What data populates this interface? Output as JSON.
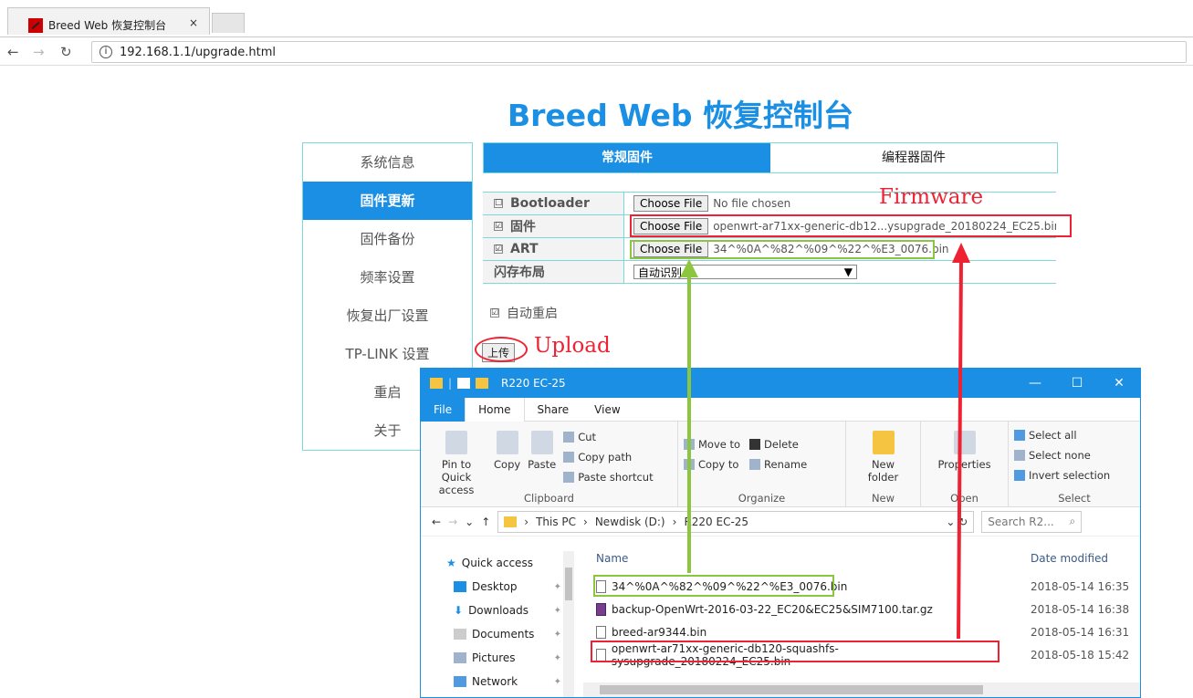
{
  "browser": {
    "tab_title": "Breed Web 恢复控制台",
    "tab_close": "×",
    "url": "192.168.1.1/upgrade.html"
  },
  "page": {
    "title": "Breed Web 恢复控制台",
    "sidebar": [
      {
        "label": "系统信息"
      },
      {
        "label": "固件更新"
      },
      {
        "label": "固件备份"
      },
      {
        "label": "频率设置"
      },
      {
        "label": "恢复出厂设置"
      },
      {
        "label": "TP-LINK 设置"
      },
      {
        "label": "重启"
      },
      {
        "label": "关于"
      }
    ],
    "tabs": [
      "常规固件",
      "编程器固件"
    ],
    "rows": {
      "bootloader": {
        "label": "Bootloader",
        "button": "Choose File",
        "value": "No file chosen",
        "checked": "☐"
      },
      "firmware": {
        "label": "固件",
        "button": "Choose File",
        "value": "openwrt-ar71xx-generic-db12...ysupgrade_20180224_EC25.bin",
        "checked": "☑"
      },
      "art": {
        "label": "ART",
        "button": "Choose File",
        "value": "34^%0A^%82^%09^%22^%E3_0076.bin",
        "checked": "☑"
      },
      "flash": {
        "label": "闪存布局",
        "select": "自动识别",
        "arrow": "▼"
      }
    },
    "auto_reboot": {
      "label": "自动重启",
      "checked": "☑"
    },
    "upload_button": "上传"
  },
  "annotations": {
    "firmware": "Firmware",
    "upload": "Upload"
  },
  "explorer": {
    "title": "R220 EC-25",
    "controls": [
      "—",
      "☐",
      "✕"
    ],
    "ribbon_tabs": [
      "File",
      "Home",
      "Share",
      "View"
    ],
    "clipboard": {
      "pin": "Pin to Quick access",
      "copy": "Copy",
      "paste": "Paste",
      "cut": "Cut",
      "copy_path": "Copy path",
      "paste_shortcut": "Paste shortcut",
      "label": "Clipboard"
    },
    "organize": {
      "move_to": "Move to",
      "copy_to": "Copy to",
      "delete": "Delete",
      "rename": "Rename",
      "label": "Organize"
    },
    "new": {
      "new_folder": "New folder",
      "label": "New"
    },
    "open": {
      "properties": "Properties",
      "label": "Open"
    },
    "select": {
      "all": "Select all",
      "none": "Select none",
      "invert": "Invert selection",
      "label": "Select"
    },
    "path": [
      "This PC",
      "Newdisk (D:)",
      "R220 EC-25"
    ],
    "search_placeholder": "Search R2...",
    "nav": {
      "quick_access": "Quick access",
      "items": [
        "Desktop",
        "Downloads",
        "Documents",
        "Pictures",
        "Network"
      ]
    },
    "columns": {
      "name": "Name",
      "date": "Date modified"
    },
    "files": [
      {
        "name": "34^%0A^%82^%09^%22^%E3_0076.bin",
        "date": "2018-05-14 16:35"
      },
      {
        "name": "backup-OpenWrt-2016-03-22_EC20&EC25&SIM7100.tar.gz",
        "date": "2018-05-14 16:38"
      },
      {
        "name": "breed-ar9344.bin",
        "date": "2018-05-14 16:31"
      },
      {
        "name": "openwrt-ar71xx-generic-db120-squashfs-sysupgrade_20180224_EC25.bin",
        "date": "2018-05-18 15:42"
      }
    ]
  },
  "colors": {
    "accent": "#1a8fe3",
    "highlight_red": "#e23",
    "highlight_green": "#8cc63f",
    "border": "#7dd9d9"
  }
}
